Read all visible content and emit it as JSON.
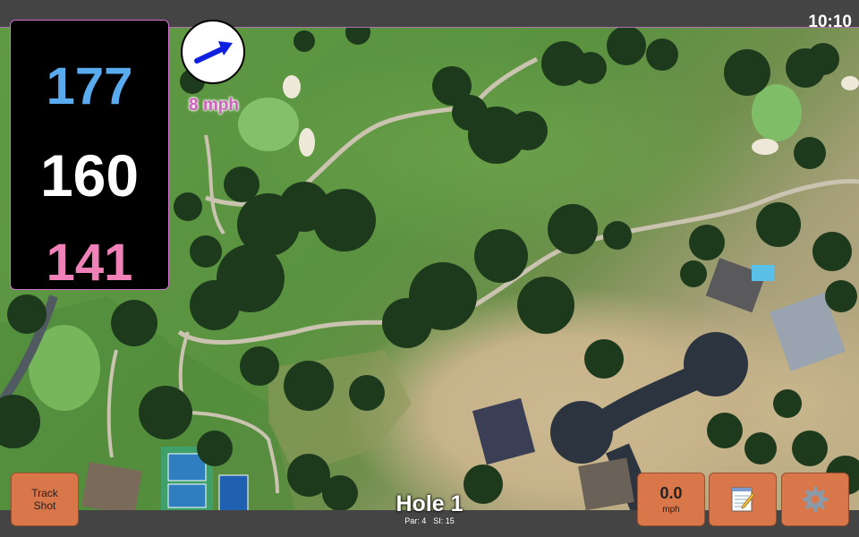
{
  "status": {
    "time": "10:10"
  },
  "distances": {
    "back": "177",
    "middle": "160",
    "front": "141"
  },
  "wind": {
    "speed": "8 mph",
    "icon": "wind-direction-arrow-icon"
  },
  "hole": {
    "title": "Hole 1",
    "par": "Par: 4",
    "stroke_index": "SI: 15"
  },
  "buttons": {
    "track_shot": "Track\nShot",
    "speed_value": "0.0",
    "speed_unit": "mph",
    "notes_icon": "notepad-icon",
    "settings_icon": "gear-icon"
  },
  "colors": {
    "back": "#5aaaf0",
    "middle": "#ffffff",
    "front": "#f080b8",
    "wind_text": "#d060c0",
    "button": "#d9764a"
  }
}
